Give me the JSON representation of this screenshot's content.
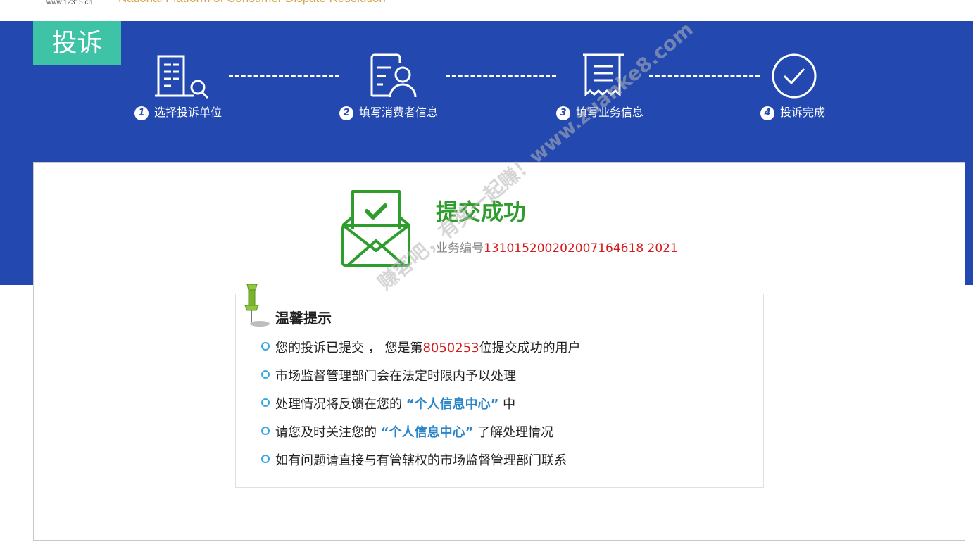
{
  "header": {
    "site_url": "www.12315.cn",
    "site_name_en": "National Platform of Consumer Dispute Resolution"
  },
  "banner": {
    "tag": "投诉",
    "steps": [
      {
        "num": "1",
        "label": "选择投诉单位",
        "icon": "building-search-icon"
      },
      {
        "num": "2",
        "label": "填写消费者信息",
        "icon": "user-document-icon"
      },
      {
        "num": "3",
        "label": "填写业务信息",
        "icon": "receipt-icon"
      },
      {
        "num": "4",
        "label": "投诉完成",
        "icon": "check-circle-icon"
      }
    ]
  },
  "result": {
    "title": "提交成功",
    "order_label": "业务编号",
    "order_no": "131015200202007164618 2021",
    "icon": "envelope-check-icon"
  },
  "watermark": "赚客吧，有奖一起赚！www.zuanke8.com",
  "tips": {
    "title": "温馨提示",
    "items": [
      {
        "pre": "您的投诉已提交 ， 您是第",
        "value": "8050253",
        "post": "位提交成功的用户"
      },
      {
        "text": "市场监督管理部门会在法定时限内予以处理"
      },
      {
        "pre": "处理情况将反馈在您的 ",
        "highlight": "“个人信息中心”",
        "post": " 中"
      },
      {
        "pre": "请您及时关注您的 ",
        "highlight": "“个人信息中心”",
        "post": " 了解处理情况"
      },
      {
        "text": "如有问题请直接与有管辖权的市场监督管理部门联系"
      }
    ]
  },
  "colors": {
    "banner": "#2349b0",
    "tag": "#3ec3a7",
    "success": "#2e9d2c",
    "red": "#d61a1a",
    "link": "#2a85c9"
  }
}
